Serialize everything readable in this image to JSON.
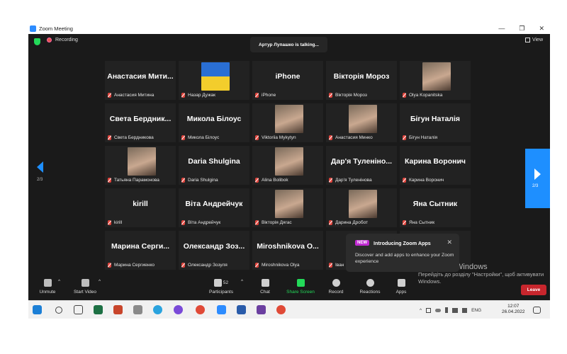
{
  "window": {
    "title": "Zoom Meeting",
    "minimize": "—",
    "restore": "❐",
    "close": "✕"
  },
  "topbar": {
    "recording": "Recording",
    "talking": "Артур Лупашко is talking...",
    "view": "View"
  },
  "tiles": [
    {
      "big": "Анастасия Мити...",
      "name": "Анастасия Митина"
    },
    {
      "big": "",
      "name": "Назар Дужак",
      "photo": "ukraine-flag"
    },
    {
      "big": "iPhone",
      "name": "iPhone"
    },
    {
      "big": "Вікторія Мороз",
      "name": "Вікторія Мороз"
    },
    {
      "big": "",
      "name": "Olya Kopanitska",
      "photo": "person-photo"
    },
    {
      "big": "Света Бердник...",
      "name": "Света Бердникова"
    },
    {
      "big": "Микола Білоус",
      "name": "Микола Білоус"
    },
    {
      "big": "",
      "name": "Viktoriia Mykytyn",
      "photo": "person-photo"
    },
    {
      "big": "",
      "name": "Анастасия Минко",
      "photo": "person-photo"
    },
    {
      "big": "Бігун Наталія",
      "name": "Бігун Наталія"
    },
    {
      "big": "",
      "name": "Татьяна Парамонова",
      "photo": "person-photo"
    },
    {
      "big": "Daria Shulgina",
      "name": "Daria Shulgina"
    },
    {
      "big": "",
      "name": "Alina Bolibok",
      "photo": "person-photo"
    },
    {
      "big": "Дар'я Туленіно...",
      "name": "Дар'я Туленінова"
    },
    {
      "big": "Карина Воронич",
      "name": "Карина Воронич"
    },
    {
      "big": "kirill",
      "name": "kirill"
    },
    {
      "big": "Віта Андрейчук",
      "name": "Віта Андрейчук"
    },
    {
      "big": "",
      "name": "Вікторія Дягас",
      "photo": "person-photo"
    },
    {
      "big": "",
      "name": "Дарина Дробот",
      "photo": "person-photo"
    },
    {
      "big": "Яна Сытник",
      "name": "Яна Сытник"
    },
    {
      "big": "Марина Серги...",
      "name": "Марина Сергиенко"
    },
    {
      "big": "Олександр Зоз...",
      "name": "Олександр Зозуля"
    },
    {
      "big": "Miroshnikova O...",
      "name": "Miroshnikova Olya"
    },
    {
      "big": "",
      "name": "Іван"
    },
    {
      "big": "...с...",
      "name": ""
    }
  ],
  "pager": {
    "left": "2/3",
    "right": "2/3"
  },
  "popup": {
    "badge": "NEW",
    "title": "Introducing Zoom Apps",
    "body": "Discover and add apps to enhance your Zoom experience",
    "close": "✕"
  },
  "watermark": {
    "line1": "Активація Windows",
    "line2": "Перейдіть до розділу \"Настройки\", щоб активувати Windows."
  },
  "toolbar": {
    "unmute": "Unmute",
    "start_video": "Start Video",
    "participants": "Participants",
    "participants_count": "52",
    "chat": "Chat",
    "share_screen": "Share Screen",
    "record": "Record",
    "reactions": "Reactions",
    "apps": "Apps",
    "leave": "Leave",
    "caret": "^"
  },
  "taskbar": {
    "lang": "ENG",
    "time": "12:07",
    "date": "26.04.2022",
    "tray_caret": "^"
  },
  "colors": {
    "accent": "#1e8fff",
    "share": "#23d959",
    "leave": "#c8262d",
    "muted": "#e2463e",
    "badge": "#c12ad2"
  }
}
